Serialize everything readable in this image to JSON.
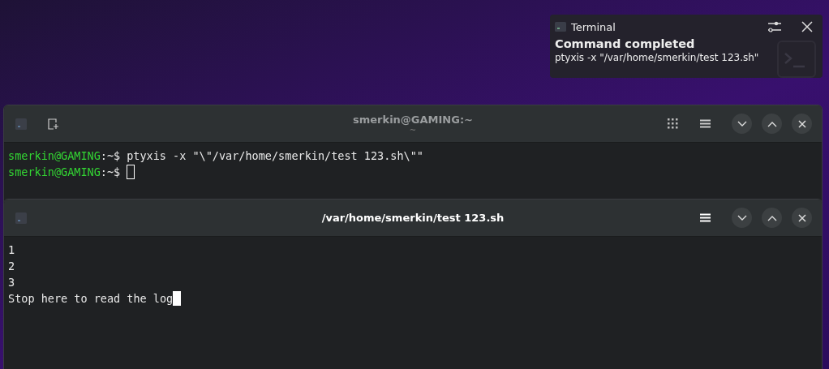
{
  "notification": {
    "app": "Terminal",
    "title": "Command completed",
    "body": "ptyxis -x \"/var/home/smerkin/test 123.sh\""
  },
  "windows": [
    {
      "title": "smerkin@GAMING:~",
      "subtitle": "~",
      "focused": false,
      "new_tab_button": true,
      "tab_overview_button": true,
      "lines": [
        {
          "kind": "prompt",
          "user": "smerkin@GAMING",
          "sep": ":~$",
          "command": "ptyxis -x \"\\\"/var/home/smerkin/test 123.sh\\\"\""
        },
        {
          "kind": "prompt",
          "user": "smerkin@GAMING",
          "sep": ":~$",
          "cursor": true
        }
      ]
    },
    {
      "title": "/var/home/smerkin/test 123.sh",
      "focused": true,
      "new_tab_button": false,
      "tab_overview_button": false,
      "lines": [
        {
          "kind": "output",
          "text": "1"
        },
        {
          "kind": "output",
          "text": "2"
        },
        {
          "kind": "output",
          "text": "3"
        },
        {
          "kind": "output",
          "text": "Stop here to read the log",
          "cursor": true
        }
      ]
    }
  ]
}
